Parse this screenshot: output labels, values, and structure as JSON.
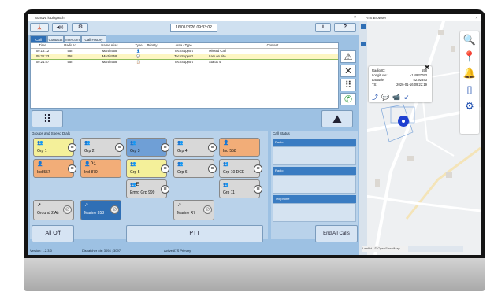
{
  "dispatch": {
    "window_title": "Sonova ioDispatch",
    "close_glyph": "×",
    "toolbar": {
      "speaker_icon": "◀)))",
      "gear_icon": "⚙",
      "clock": "16/01/2026 09:33:02",
      "info_label": "i",
      "help_label": "?",
      "alert_icon": "🗼"
    },
    "tabs": [
      "Call Stack",
      "Contacts",
      "Intercom",
      "Call History"
    ],
    "call_columns": [
      "Time",
      "Radio Id",
      "Name Alias",
      "Type",
      "Priority",
      "Area / Type",
      "Content"
    ],
    "call_rows": [
      {
        "time": "09:18:12",
        "radio_id": "558",
        "alias": "Martin558",
        "type": "👤",
        "priority": "",
        "area": "TechSupport",
        "content": "Missed Call"
      },
      {
        "time": "09:21:23",
        "radio_id": "558",
        "alias": "Martin558",
        "type": "💬",
        "priority": "",
        "area": "TechSupport",
        "content": "I am on site"
      },
      {
        "time": "09:21:57",
        "radio_id": "558",
        "alias": "Martin558",
        "type": "📋",
        "priority": "",
        "area": "TechSupport",
        "content": "Status 4"
      }
    ],
    "side_icons": {
      "mute": "⚠",
      "cross": "✕",
      "keypad": "⠿",
      "phone": "✆"
    },
    "keypad_icon": "⠿",
    "map_icon": "⛰",
    "dial_section_label": "Groups and Speed Dials",
    "tiles": [
      {
        "icon": "👥",
        "label": "Grp 1",
        "menu": "≡",
        "color": "yellow"
      },
      {
        "icon": "👥",
        "label": "Grp 2",
        "menu": "≡",
        "color": "grey"
      },
      {
        "icon": "👥",
        "label": "Grp 3",
        "menu": "≡",
        "color": "blue"
      },
      {
        "icon": "👥",
        "label": "Grp 4",
        "menu": "≡",
        "color": "grey"
      },
      {
        "icon": "👤",
        "label": "Ind 558",
        "menu": "",
        "color": "orange"
      },
      {
        "icon": "👤",
        "label": "Ind 557",
        "menu": "≡",
        "color": "orange"
      },
      {
        "icon": "👤P1",
        "label": "Ind 870",
        "menu": "",
        "color": "orange"
      },
      {
        "icon": "👥",
        "label": "Grp 5",
        "menu": "≡",
        "color": "yellow"
      },
      {
        "icon": "👥",
        "label": "Grp 6",
        "menu": "≡",
        "color": "grey"
      },
      {
        "icon": "👥",
        "label": "Grp 10 DCE",
        "menu": "≡",
        "color": "grey"
      },
      {
        "icon": "👥E",
        "label": "Emrg Grp 999",
        "menu": "≡",
        "color": "grey"
      },
      {
        "icon": "👥",
        "label": "Grp 11",
        "menu": "≡",
        "color": "grey"
      },
      {
        "icon": "↗",
        "label": "Ground 2 Air",
        "menu": "⊘",
        "color": "grey"
      },
      {
        "icon": "↗",
        "label": "Marine 358",
        "menu": "⊘",
        "color": "darkblue"
      },
      {
        "icon": "↗",
        "label": "Marine R7",
        "menu": "⊘",
        "color": "grey"
      }
    ],
    "call_status": {
      "label": "Call Status",
      "rows": [
        "Radio",
        "Radio",
        "Telephone"
      ]
    },
    "footer": {
      "all_off": "All Off",
      "ptt": "PTT",
      "end_all": "End All Calls"
    },
    "status_bar": {
      "version": "Version: 1.2.3.0",
      "dispatcher": "Dispatcher Ids: 3094 ; 3097",
      "ats": "Active ATS Primary"
    }
  },
  "map": {
    "window_title": "ATS Browser",
    "close_glyph": "×",
    "popup": {
      "close": "✖",
      "rows": [
        {
          "k": "Radio ID:",
          "v": "558"
        },
        {
          "k": "Longitude:",
          "v": "-1.4937093"
        },
        {
          "k": "Latitude:",
          "v": "52.92343"
        },
        {
          "k": "TS:",
          "v": "2026-01-16 09:22:19"
        }
      ],
      "actions": "⤴ 💬 📹 ↙"
    },
    "side_icons": [
      "🔍",
      "📍",
      "🔔",
      "▯",
      "⚙"
    ],
    "marker_label": "558",
    "scale_text": "Leaflet | © OpenStreetMap"
  }
}
